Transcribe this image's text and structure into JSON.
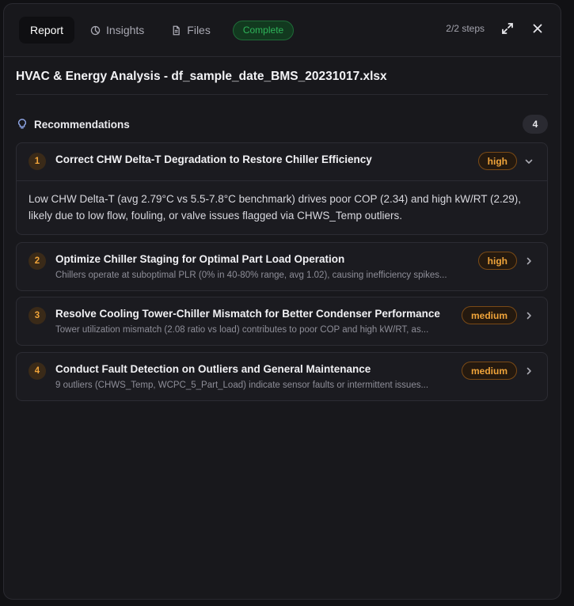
{
  "tabs": [
    {
      "label": "Report",
      "icon": "none"
    },
    {
      "label": "Insights",
      "icon": "pie-chart-icon"
    },
    {
      "label": "Files",
      "icon": "file-icon"
    }
  ],
  "status": "Complete",
  "steps": "2/2 steps",
  "title": "HVAC & Energy Analysis - df_sample_date_BMS_20231017.xlsx",
  "section": {
    "title": "Recommendations",
    "count": "4"
  },
  "recommendations": [
    {
      "num": "1",
      "title": "Correct CHW Delta-T Degradation to Restore Chiller Efficiency",
      "priority": "high",
      "expanded": true,
      "detail": "Low CHW Delta-T (avg 2.79°C vs 5.5-7.8°C benchmark) drives poor COP (2.34) and high kW/RT (2.29), likely due to low flow, fouling, or valve issues flagged via CHWS_Temp outliers."
    },
    {
      "num": "2",
      "title": "Optimize Chiller Staging for Optimal Part Load Operation",
      "priority": "high",
      "summary": "Chillers operate at suboptimal PLR (0% in 40-80% range, avg 1.02), causing inefficiency spikes..."
    },
    {
      "num": "3",
      "title": "Resolve Cooling Tower-Chiller Mismatch for Better Condenser Performance",
      "priority": "medium",
      "summary": "Tower utilization mismatch (2.08 ratio vs load) contributes to poor COP and high kW/RT, as..."
    },
    {
      "num": "4",
      "title": "Conduct Fault Detection on Outliers and General Maintenance",
      "priority": "medium",
      "summary": "9 outliers (CHWS_Temp, WCPC_5_Part_Load) indicate sensor faults or intermittent issues..."
    }
  ],
  "colors": {
    "accent_orange": "#f0a43a",
    "status_green": "#2fb45a",
    "panel_bg": "#18181c",
    "bulb_blue": "#8fa6e6"
  }
}
